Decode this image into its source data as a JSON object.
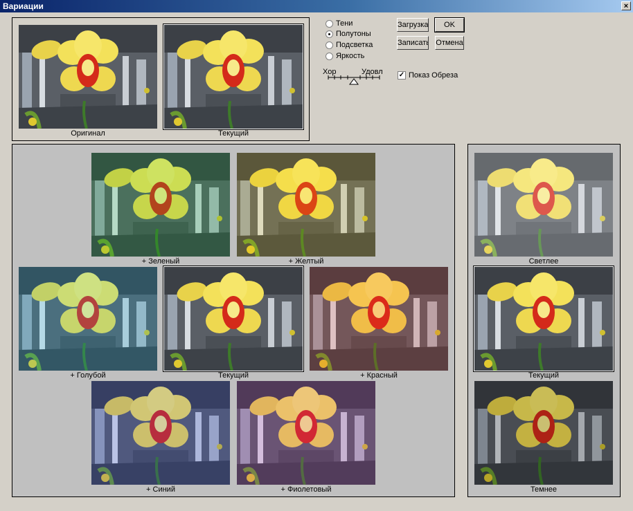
{
  "window": {
    "title": "Вариации",
    "close_label": "×"
  },
  "mode": {
    "options": [
      "Тени",
      "Полутоны",
      "Подсветка",
      "Яркость"
    ],
    "selected_index": 1
  },
  "slider": {
    "left_label": "Хор",
    "right_label": "Удовл"
  },
  "buttons": {
    "load": "Загрузка",
    "ok": "OK",
    "save": "Записать",
    "cancel": "Отмена"
  },
  "show_clipping": {
    "label": "Показ Обреза",
    "checked": true
  },
  "top": {
    "original": "Оригинал",
    "current": "Текущий"
  },
  "color_panel": {
    "green": "+ Зеленый",
    "yellow": "+ Желтый",
    "cyan": "+ Голубой",
    "current": "Текущий",
    "red": "+ Красный",
    "blue": "+ Синий",
    "magenta": "+ Фиолетовый"
  },
  "brightness_panel": {
    "lighter": "Светлее",
    "current": "Текущий",
    "darker": "Темнее"
  },
  "tint_colors": {
    "original": "#000000",
    "current": "#000000",
    "green": "#00cc33",
    "yellow": "#ffd200",
    "cyan": "#00c8ff",
    "red": "#ff3020",
    "blue": "#2040ff",
    "magenta": "#c020c0",
    "lighter": "#ffffff",
    "darker": "#000000"
  }
}
